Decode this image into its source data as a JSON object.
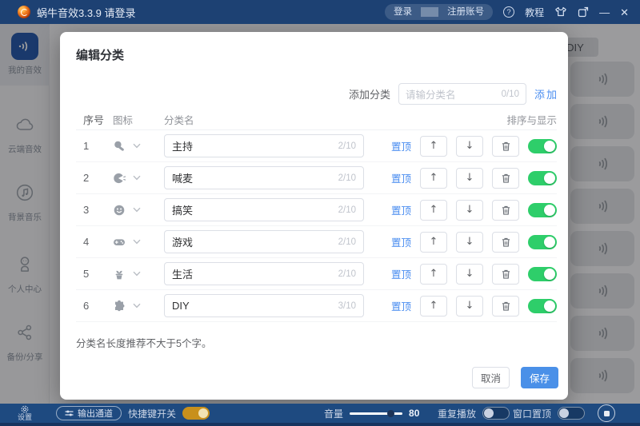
{
  "titlebar": {
    "title": "蜗牛音效3.3.9 请登录",
    "login": "登录",
    "register": "注册账号",
    "tutorial": "教程"
  },
  "icons": {
    "question": "?",
    "minimize": "—",
    "close": "✕",
    "up": "↑",
    "down": "↓"
  },
  "sidebar": {
    "items": [
      {
        "label": "我的音效",
        "icon": "sound-wave-icon",
        "active": true
      },
      {
        "label": "云端音效",
        "icon": "cloud-icon",
        "active": false
      },
      {
        "label": "背景音乐",
        "icon": "music-icon",
        "active": false
      },
      {
        "label": "个人中心",
        "icon": "person-icon",
        "active": false
      },
      {
        "label": "备份/分享",
        "icon": "share-icon",
        "active": false
      }
    ],
    "settings": "设置"
  },
  "modal": {
    "title": "编辑分类",
    "add": {
      "label": "添加分类",
      "placeholder": "请输分类名",
      "counter": "0/10",
      "button": "添加"
    },
    "headers": {
      "index": "序号",
      "icon": "图标",
      "name": "分类名",
      "sort": "排序与显示"
    },
    "rows": [
      {
        "index": "1",
        "icon": "microphone-icon",
        "name": "主持",
        "counter": "2/10",
        "pin_label": "置顶",
        "enabled": true
      },
      {
        "index": "2",
        "icon": "shout-face-icon",
        "name": "喊麦",
        "counter": "2/10",
        "pin_label": "置顶",
        "enabled": true
      },
      {
        "index": "3",
        "icon": "smiley-icon",
        "name": "搞笑",
        "counter": "2/10",
        "pin_label": "置顶",
        "enabled": true
      },
      {
        "index": "4",
        "icon": "gamepad-icon",
        "name": "游戏",
        "counter": "2/10",
        "pin_label": "置顶",
        "enabled": true
      },
      {
        "index": "5",
        "icon": "plant-icon",
        "name": "生活",
        "counter": "2/10",
        "pin_label": "置顶",
        "enabled": true
      },
      {
        "index": "6",
        "icon": "puzzle-icon",
        "name": "DIY",
        "counter": "3/10",
        "pin_label": "置顶",
        "enabled": true
      }
    ],
    "note": "分类名长度推荐不大于5个字。",
    "cancel": "取消",
    "save": "保存"
  },
  "background": {
    "diy_tab": "DIY",
    "sound_card_count": 8
  },
  "bottombar": {
    "output_channel": "输出通道",
    "hotkey": "快捷键开关",
    "hotkey_on": true,
    "volume_label": "音量",
    "volume_value": "80",
    "volume_percent": 78,
    "repeat": "重复播放",
    "repeat_on": false,
    "window_top": "窗口置顶",
    "window_top_on": false
  },
  "colors": {
    "titlebar": "#1d4173",
    "bottombar": "#1e4a80",
    "accent": "#4a90e8",
    "link": "#4a8df0",
    "toggle_green": "#2ece6a",
    "toggle_orange": "#c8901c"
  }
}
